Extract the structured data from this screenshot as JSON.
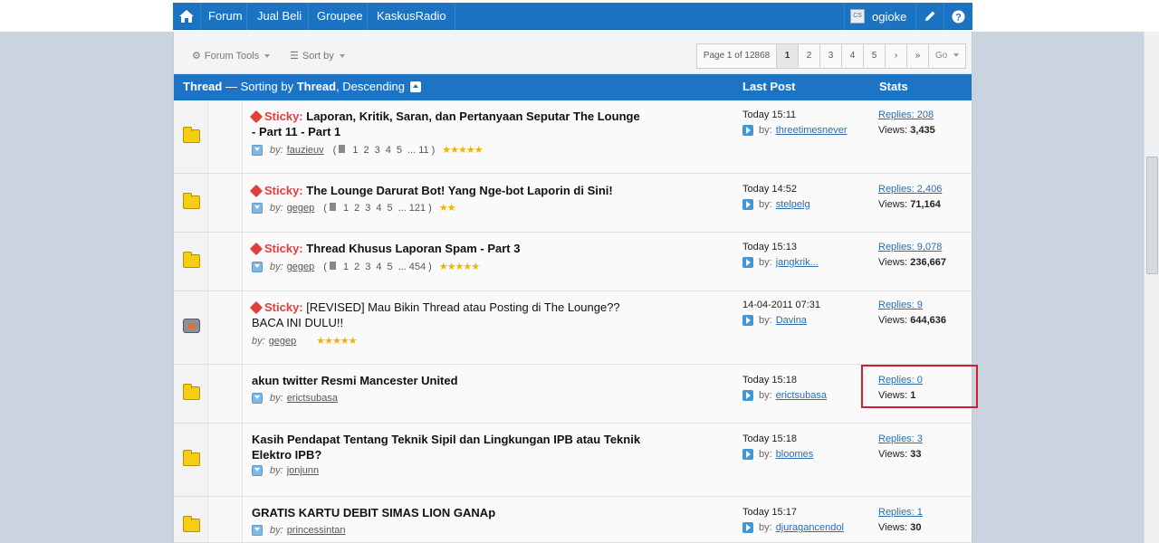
{
  "nav": {
    "items": [
      "Forum",
      "Jual Beli",
      "Groupee",
      "KaskusRadio"
    ],
    "avatar_text": "CS",
    "username": "ogioke"
  },
  "toolbar": {
    "forum_tools": "Forum Tools",
    "sort_by": "Sort by",
    "page_label": "Page 1 of 12868",
    "pages": [
      "1",
      "2",
      "3",
      "4",
      "5"
    ],
    "go": "Go"
  },
  "header": {
    "thread": "Thread",
    "sort_prefix": " — Sorting by ",
    "sort_field": "Thread",
    "sort_suffix": ", Descending",
    "last_post": "Last Post",
    "stats": "Stats"
  },
  "labels": {
    "sticky": "Sticky:",
    "by": "by:",
    "lp_by": "by:",
    "views": "Views:"
  },
  "threads": [
    {
      "sticky": true,
      "bold": true,
      "title": "Laporan, Kritik, Saran, dan Pertanyaan Seputar The Lounge - Part 11 - Part 1",
      "author": "fauzieuv",
      "pages": [
        "1",
        "2",
        "3",
        "4",
        "5",
        "... 11"
      ],
      "rating": 5,
      "last_time": "Today 15:11",
      "last_user": "threetimesnever",
      "replies": "Replies: 208",
      "views": "3,435"
    },
    {
      "sticky": true,
      "bold": true,
      "title": "The Lounge Darurat Bot! Yang Nge-bot Laporin di Sini!",
      "author": "gegep",
      "pages": [
        "1",
        "2",
        "3",
        "4",
        "5",
        "... 121"
      ],
      "rating": 2,
      "last_time": "Today 14:52",
      "last_user": "stelpelg",
      "replies": "Replies: 2,406",
      "views": "71,164"
    },
    {
      "sticky": true,
      "bold": true,
      "title": "Thread Khusus Laporan Spam - Part 3",
      "author": "gegep",
      "pages": [
        "1",
        "2",
        "3",
        "4",
        "5",
        "... 454"
      ],
      "rating": 5,
      "last_time": "Today 15:13",
      "last_user": "jangkrik...",
      "replies": "Replies: 9,078",
      "views": "236,667"
    },
    {
      "sticky": true,
      "bold": false,
      "title": "[REVISED] Mau Bikin Thread atau Posting di The Lounge?? BACA INI DULU!!",
      "author": "gegep",
      "pages": [],
      "rating": 5,
      "last_time": "14-04-2011 07:31",
      "last_user": "Davina",
      "replies": "Replies: 9",
      "views": "644,636"
    },
    {
      "sticky": false,
      "bold": true,
      "title": "akun twitter Resmi Mancester United",
      "author": "erictsubasa",
      "pages": [],
      "rating": 0,
      "last_time": "Today 15:18",
      "last_user": "erictsubasa",
      "replies": "Replies: 0",
      "views": "1"
    },
    {
      "sticky": false,
      "bold": true,
      "title": "Kasih Pendapat Tentang Teknik Sipil dan Lingkungan IPB atau Teknik Elektro IPB?",
      "author": "jonjunn",
      "pages": [],
      "rating": 0,
      "last_time": "Today 15:18",
      "last_user": "bloomes",
      "replies": "Replies: 3",
      "views": "33"
    },
    {
      "sticky": false,
      "bold": true,
      "title": "GRATIS KARTU DEBIT SIMAS LION GANAp",
      "author": "princessintan",
      "pages": [],
      "rating": 0,
      "last_time": "Today 15:17",
      "last_user": "djuragancendol",
      "replies": "Replies: 1",
      "views": "30"
    }
  ]
}
